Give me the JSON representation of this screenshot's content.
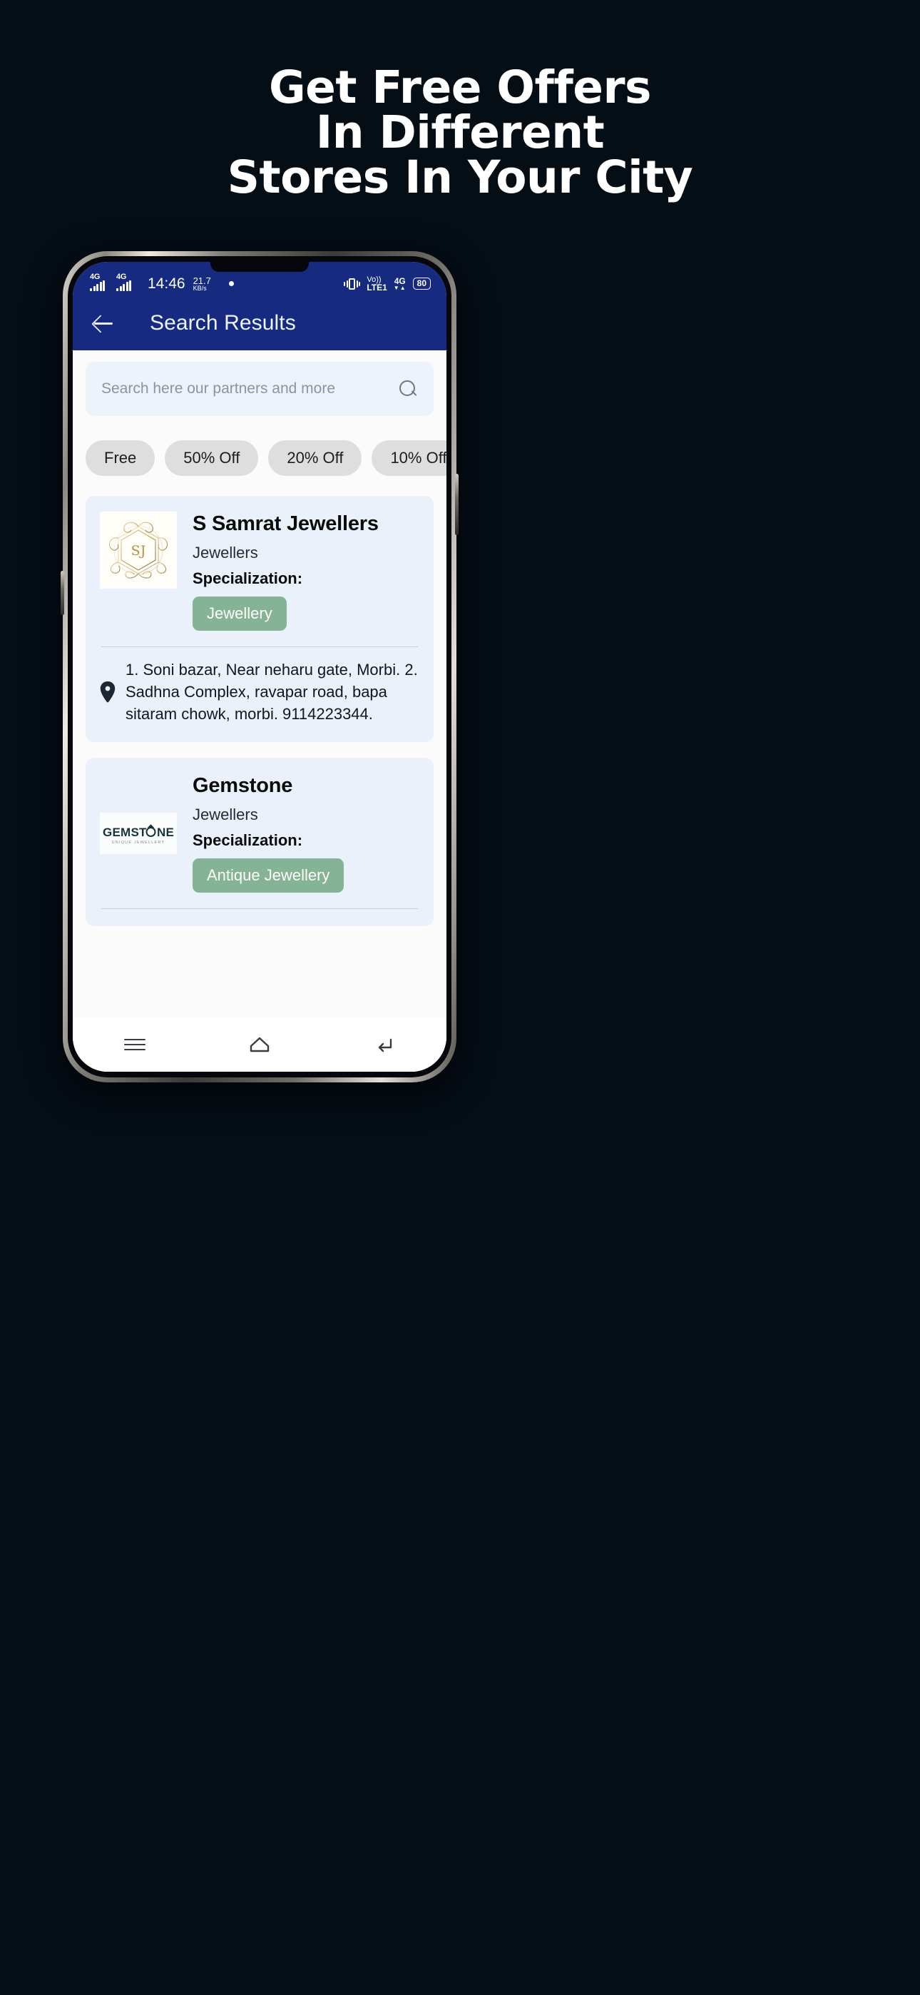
{
  "promo": {
    "headline_lines": [
      "Get Free Offers",
      "In Different",
      "Stores In Your City"
    ],
    "background_color": "#050d15",
    "text_color": "#ffffff"
  },
  "status_bar": {
    "sim1_network": "4G",
    "sim2_network": "4G",
    "time": "14:46",
    "net_speed_value": "21.7",
    "net_speed_unit": "KB/s",
    "volte_line1": "Vo))",
    "volte_line2": "LTE1",
    "data_network": "4G",
    "data_network_sub": "▼▲",
    "battery_level": "80",
    "background_color": "#162a80"
  },
  "app_bar": {
    "back_label": "back-arrow",
    "title": "Search Results",
    "background_color": "#152a80"
  },
  "search": {
    "placeholder": "Search here our partners and more",
    "value": "",
    "icon": "search-icon"
  },
  "filter_chips": [
    {
      "label": "Free"
    },
    {
      "label": "50% Off"
    },
    {
      "label": "20% Off"
    },
    {
      "label": "10% Off"
    }
  ],
  "results": [
    {
      "name": "S Samrat Jewellers",
      "category": "Jewellers",
      "specialization_label": "Specialization:",
      "specialization_tag": "Jewellery",
      "address": "1. Soni bazar, Near neharu gate, Morbi. 2. Sadhna Complex, ravapar road, bapa sitaram chowk, morbi. 9114223344.",
      "logo_text": "SJ",
      "logo_icon": "sj-monogram-logo"
    },
    {
      "name": "Gemstone",
      "category": "Jewellers",
      "specialization_label": "Specialization:",
      "specialization_tag": "Antique Jewellery",
      "address": "",
      "logo_text": "GEMSTONE",
      "logo_subtext": "UNIQUE JEWELLERY",
      "logo_icon": "gemstone-ring-logo"
    }
  ],
  "nav_bar": {
    "items": [
      {
        "icon": "recents-menu-icon",
        "label": "Recents"
      },
      {
        "icon": "home-icon",
        "label": "Home"
      },
      {
        "icon": "back-nav-icon",
        "label": "Back"
      }
    ]
  },
  "theme": {
    "accent_blue": "#152a80",
    "card_bg": "#eaf1fb",
    "chip_bg": "#dedede",
    "tag_green": "#84b396"
  }
}
